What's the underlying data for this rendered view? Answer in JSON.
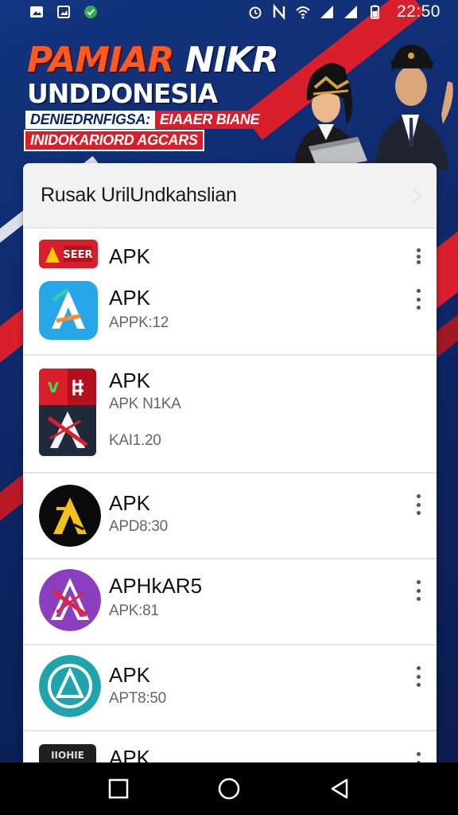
{
  "status_bar": {
    "time": "22:50",
    "left_icons": [
      "image-notification-icon",
      "gallery-notification-icon",
      "green-app-notification-icon"
    ],
    "right_icons": [
      "alarm-icon",
      "nfc-icon",
      "wifi-icon",
      "signal-icon",
      "signal-icon-2",
      "battery-icon"
    ]
  },
  "banner": {
    "title_part1": "PAMIAR",
    "title_part2": "NIKR",
    "title_line2": "UNDDONESIA",
    "subtitle_white": "DENIEDRNFIGSA:",
    "subtitle_red": "EIAAER BIANE",
    "subtitle_line2": "INIDOKARIORD AGCARS"
  },
  "card": {
    "title": "Rusak UrilUndkahslian",
    "items": [
      {
        "name": "APK",
        "sub": "",
        "sub2": "",
        "icon": "red-banner-app-icon",
        "icon_text": "SEER"
      },
      {
        "name": "APK",
        "sub": "APPK:12",
        "sub2": "",
        "icon": "blue-a-app-icon"
      },
      {
        "name": "APK",
        "sub": "APK N1KA",
        "sub2": "KAI1.20",
        "icon": "red-dark-a-app-icon",
        "icon_text": "V"
      },
      {
        "name": "APK",
        "sub": "APD8:30",
        "sub2": "",
        "icon": "black-yellow-a-app-icon"
      },
      {
        "name": "APHkAR5",
        "sub": "APK:81",
        "sub2": "",
        "icon": "purple-a-app-icon"
      },
      {
        "name": "APK",
        "sub": "APT8:50",
        "sub2": "",
        "icon": "teal-a-app-icon"
      },
      {
        "name": "APK",
        "sub": "",
        "sub2": "",
        "icon": "dark-app-icon",
        "icon_text": "IIOHIE"
      }
    ]
  },
  "nav": {
    "recents_icon": "square-recents-icon",
    "home_icon": "circle-home-icon",
    "back_icon": "triangle-back-icon"
  },
  "colors": {
    "brand_blue": "#13357f",
    "brand_red": "#d81f2b",
    "accent_orange": "#ff5a1f"
  }
}
